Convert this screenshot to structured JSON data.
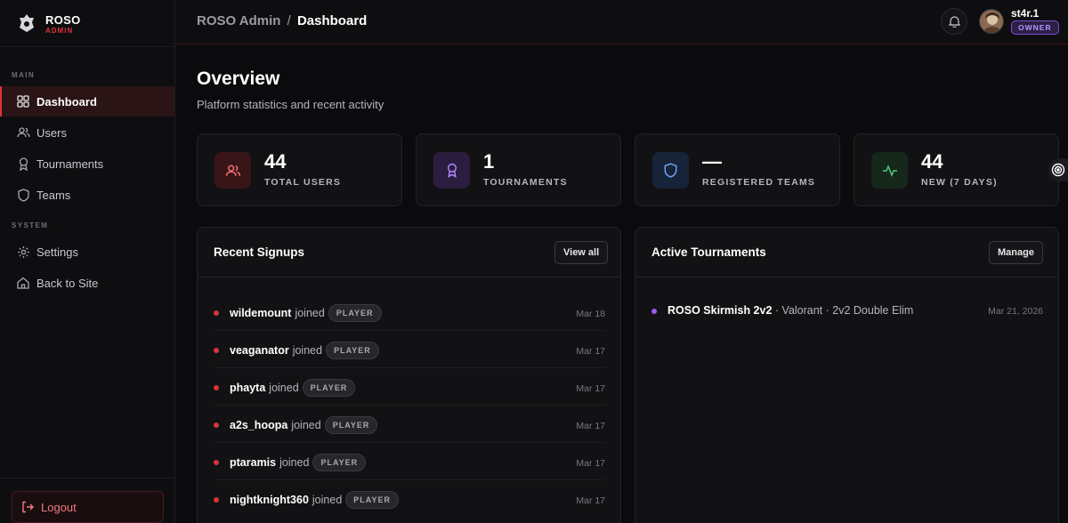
{
  "brand": {
    "name": "ROSO",
    "sub": "ADMIN"
  },
  "sidebar": {
    "sections": [
      {
        "label": "MAIN",
        "items": [
          {
            "label": "Dashboard",
            "icon": "grid-icon",
            "active": true
          },
          {
            "label": "Users",
            "icon": "users-icon"
          },
          {
            "label": "Tournaments",
            "icon": "award-icon"
          },
          {
            "label": "Teams",
            "icon": "shield-icon"
          }
        ]
      },
      {
        "label": "SYSTEM",
        "items": [
          {
            "label": "Settings",
            "icon": "gear-icon"
          },
          {
            "label": "Back to Site",
            "icon": "home-icon"
          }
        ]
      }
    ],
    "logout_label": "Logout"
  },
  "topbar": {
    "crumb_root": "ROSO Admin",
    "crumb_sep": "/",
    "crumb_current": "Dashboard",
    "user": {
      "name": "st4r.1",
      "role": "OWNER"
    }
  },
  "page": {
    "title": "Overview",
    "subtitle": "Platform statistics and recent activity"
  },
  "stats": [
    {
      "value": "44",
      "label": "TOTAL USERS",
      "icon": "users-icon",
      "color": "#f07070"
    },
    {
      "value": "1",
      "label": "TOURNAMENTS",
      "icon": "award-icon",
      "color": "#b48cff"
    },
    {
      "value": "—",
      "label": "REGISTERED TEAMS",
      "icon": "shield-icon",
      "color": "#6aa3f0"
    },
    {
      "value": "44",
      "label": "NEW (7 DAYS)",
      "icon": "activity-icon",
      "color": "#4cd07a"
    }
  ],
  "signups": {
    "title": "Recent Signups",
    "button": "View all",
    "rows": [
      {
        "name": "wildemount",
        "action": "joined",
        "badge": "PLAYER",
        "date": "Mar 18"
      },
      {
        "name": "veaganator",
        "action": "joined",
        "badge": "PLAYER",
        "date": "Mar 17"
      },
      {
        "name": "phayta",
        "action": "joined",
        "badge": "PLAYER",
        "date": "Mar 17"
      },
      {
        "name": "a2s_hoopa",
        "action": "joined",
        "badge": "PLAYER",
        "date": "Mar 17"
      },
      {
        "name": "ptaramis",
        "action": "joined",
        "badge": "PLAYER",
        "date": "Mar 17"
      },
      {
        "name": "nightknight360",
        "action": "joined",
        "badge": "PLAYER",
        "date": "Mar 17"
      }
    ]
  },
  "tournaments": {
    "title": "Active Tournaments",
    "button": "Manage",
    "rows": [
      {
        "name": "ROSO Skirmish 2v2",
        "details": " · Valorant · 2v2 Double Elim",
        "date": "Mar 21, 2026"
      }
    ]
  }
}
